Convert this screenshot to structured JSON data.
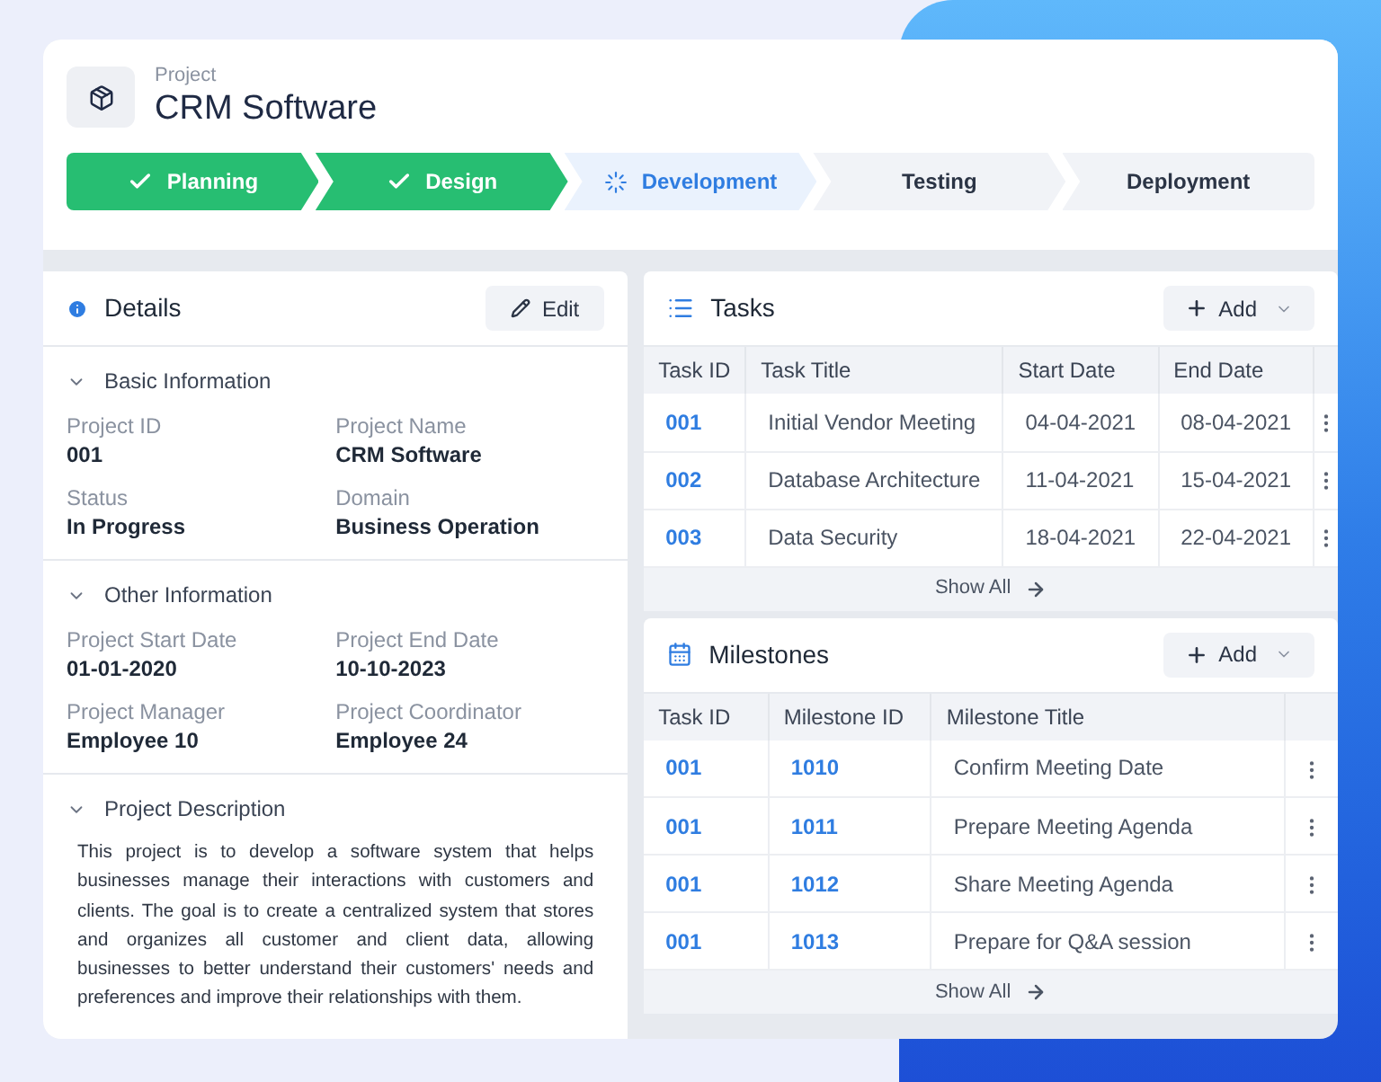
{
  "project": {
    "label": "Project",
    "title": "CRM Software"
  },
  "stages": [
    {
      "label": "Planning",
      "kind": "done"
    },
    {
      "label": "Design",
      "kind": "done"
    },
    {
      "label": "Development",
      "kind": "active"
    },
    {
      "label": "Testing",
      "kind": "todo"
    },
    {
      "label": "Deployment",
      "kind": "todo"
    }
  ],
  "details": {
    "title": "Details",
    "edit_label": "Edit",
    "sections": [
      {
        "title": "Basic Information",
        "expanded": true,
        "fields": [
          {
            "label": "Project ID",
            "value": "001"
          },
          {
            "label": "Project Name",
            "value": "CRM Software"
          },
          {
            "label": "Status",
            "value": "In Progress"
          },
          {
            "label": "Domain",
            "value": "Business Operation"
          }
        ]
      },
      {
        "title": "Other Information",
        "expanded": true,
        "fields": [
          {
            "label": "Project Start Date",
            "value": "01-01-2020"
          },
          {
            "label": "Project End Date",
            "value": "10-10-2023"
          },
          {
            "label": "Project Manager",
            "value": "Employee 10"
          },
          {
            "label": "Project Coordinator",
            "value": "Employee 24"
          }
        ]
      },
      {
        "title": "Project Description",
        "expanded": true,
        "text": "This project is to develop a software system that helps businesses manage their interactions with customers and clients. The goal is to create a centralized system that stores and organizes all customer and client data, allowing businesses to better understand their customers' needs and preferences and improve their relationships with them."
      }
    ]
  },
  "tasks": {
    "title": "Tasks",
    "add_label": "Add",
    "columns": [
      "Task ID",
      "Task Title",
      "Start Date",
      "End Date"
    ],
    "rows": [
      [
        "001",
        "Initial Vendor Meeting",
        "04-04-2021",
        "08-04-2021"
      ],
      [
        "002",
        "Database Architecture",
        "11-04-2021",
        "15-04-2021"
      ],
      [
        "003",
        "Data Security",
        "18-04-2021",
        "22-04-2021"
      ]
    ],
    "show_all": "Show All"
  },
  "milestones": {
    "title": "Milestones",
    "add_label": "Add",
    "columns": [
      "Task ID",
      "Milestone ID",
      "Milestone Title"
    ],
    "rows": [
      [
        "001",
        "1010",
        "Confirm Meeting Date"
      ],
      [
        "001",
        "1011",
        "Prepare Meeting Agenda"
      ],
      [
        "001",
        "1012",
        "Share Meeting Agenda"
      ],
      [
        "001",
        "1013",
        "Prepare for Q&A session"
      ]
    ],
    "show_all": "Show All"
  }
}
